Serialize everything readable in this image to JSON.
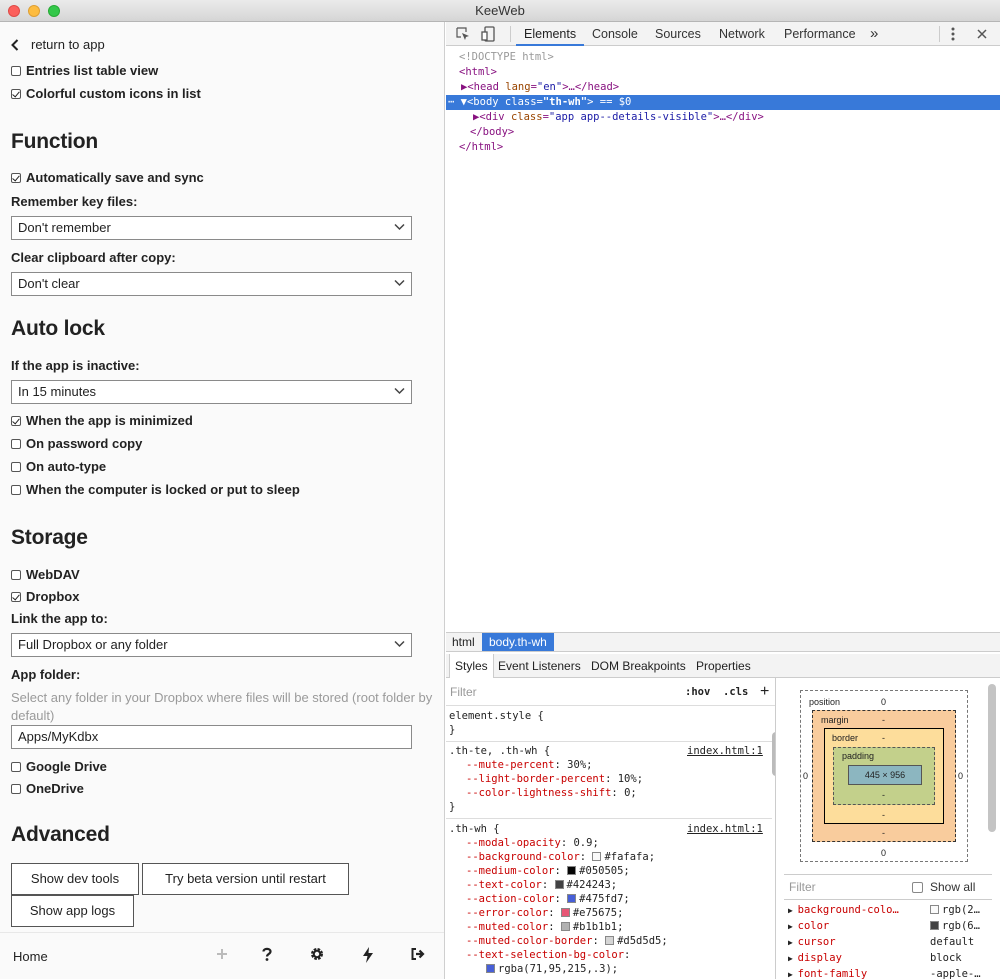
{
  "window": {
    "title": "KeeWeb"
  },
  "settings": {
    "back_label": "return to app",
    "partial_item": "Entries list table view",
    "colorful_icons": "Colorful custom icons in list",
    "function_heading": "Function",
    "auto_save": "Automatically save and sync",
    "remember_key_label": "Remember key files:",
    "remember_key_value": "Don't remember",
    "clipboard_label": "Clear clipboard after copy:",
    "clipboard_value": "Don't clear",
    "autolock_heading": "Auto lock",
    "inactive_label": "If the app is inactive:",
    "inactive_value": "In 15 minutes",
    "lock_minimized": "When the app is minimized",
    "lock_password_copy": "On password copy",
    "lock_autotype": "On auto-type",
    "lock_sleep": "When the computer is locked or put to sleep",
    "storage_heading": "Storage",
    "webdav": "WebDAV",
    "dropbox": "Dropbox",
    "link_label": "Link the app to:",
    "link_value": "Full Dropbox or any folder",
    "app_folder_label": "App folder:",
    "app_folder_desc": "Select any folder in your Dropbox where files will be stored (root folder by default)",
    "app_folder_value": "Apps/MyKdbx",
    "gdrive": "Google Drive",
    "onedrive": "OneDrive",
    "advanced_heading": "Advanced",
    "btn_devtools": "Show dev tools",
    "btn_beta": "Try beta version until restart",
    "btn_logs": "Show app logs"
  },
  "footer": {
    "home": "Home"
  },
  "devtools": {
    "tabs": [
      "Elements",
      "Console",
      "Sources",
      "Network",
      "Performance",
      "»"
    ],
    "dom": {
      "doctype": "<!DOCTYPE html>",
      "html_open": "<html>",
      "head_tag": "<head",
      "head_attr": "lang",
      "head_val": "\"en\"",
      "head_rest": ">…</head>",
      "body_tag": "<body",
      "body_attr": "class",
      "body_val": "\"th-wh\"",
      "body_rest": "> == $0",
      "div_tag": "<div",
      "div_attr": "class",
      "div_val": "\"app app--details-visible\"",
      "div_rest": ">…</div>",
      "body_close": "</body>",
      "html_close": "</html>"
    },
    "crumbs": [
      "html",
      "body.th-wh"
    ],
    "style_tabs": [
      "Styles",
      "Event Listeners",
      "DOM Breakpoints",
      "Properties"
    ],
    "filter": "Filter",
    "hov": ":hov",
    "cls": ".cls",
    "plus": "+",
    "element_style": "element.style {",
    "close_brace": "}",
    "rule1": {
      "selector": ".th-te, .th-wh {",
      "source": "index.html:1",
      "props": [
        [
          "--mute-percent",
          "30%;"
        ],
        [
          "--light-border-percent",
          "10%;"
        ],
        [
          "--color-lightness-shift",
          "0;"
        ]
      ]
    },
    "rule2": {
      "selector": ".th-wh {",
      "source": "index.html:1",
      "props": [
        [
          "--modal-opacity",
          "0.9;",
          "",
          ""
        ],
        [
          "--background-color",
          "#fafafa;",
          "#fafafa",
          "sw"
        ],
        [
          "--medium-color",
          "#050505;",
          "#050505",
          "sw"
        ],
        [
          "--text-color",
          "#424243;",
          "#424243",
          "sw"
        ],
        [
          "--action-color",
          "#475fd7;",
          "#475fd7",
          "sw"
        ],
        [
          "--error-color",
          "#e75675;",
          "#e75675",
          "sw"
        ],
        [
          "--muted-color",
          "#b1b1b1;",
          "#b1b1b1",
          "sw"
        ],
        [
          "--muted-color-border",
          "#d5d5d5;",
          "#d5d5d5",
          "sw"
        ],
        [
          "--text-selection-bg-color",
          "",
          "",
          ""
        ]
      ],
      "last_value": "rgba(71,95,215,.3);",
      "last_color": "#475fd7"
    },
    "boxmodel": {
      "position": "position",
      "margin": "margin",
      "border": "border",
      "padding": "padding",
      "content": "445 × 956",
      "zero": "0",
      "dash": "-"
    },
    "computed_filter": "Filter",
    "show_all": "Show all",
    "computed": [
      [
        "background-colo…",
        "rgb(2…",
        "#fafafa"
      ],
      [
        "color",
        "rgb(6…",
        "#424243"
      ],
      [
        "cursor",
        "default",
        ""
      ],
      [
        "display",
        "block",
        ""
      ],
      [
        "font-family",
        "-apple-…",
        ""
      ]
    ]
  }
}
